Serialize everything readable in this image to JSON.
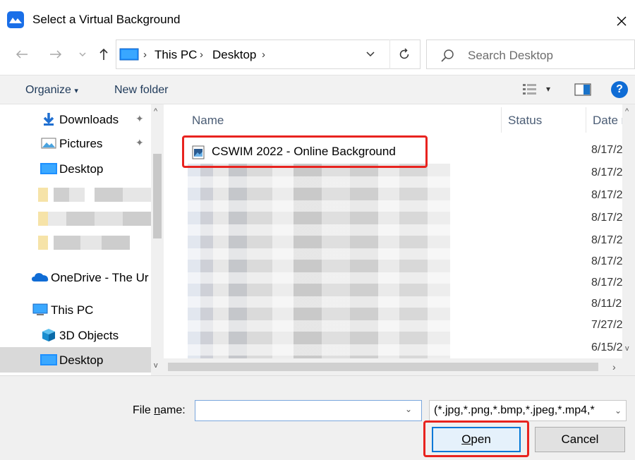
{
  "window": {
    "title": "Select a Virtual Background",
    "close_glyph": "✕"
  },
  "navigation": {
    "back_glyph": "←",
    "forward_glyph": "→",
    "recent_glyph": "⌄",
    "up_glyph": "↑"
  },
  "address_bar": {
    "breadcrumbs": [
      "This PC",
      "Desktop"
    ],
    "separator": "›",
    "dropdown_glyph": "⌄",
    "refresh_glyph": "↻"
  },
  "search": {
    "placeholder": "Search Desktop"
  },
  "command_bar": {
    "organize_label": "Organize",
    "organize_caret": "▾",
    "new_folder_label": "New folder",
    "view_caret": "▾",
    "help_glyph": "?"
  },
  "nav_pane": {
    "items": [
      {
        "label": "Downloads",
        "icon": "download-arrow-icon",
        "pinned": true
      },
      {
        "label": "Pictures",
        "icon": "pictures-folder-icon",
        "pinned": true
      },
      {
        "label": "Desktop",
        "icon": "desktop-folder-icon",
        "pinned": false
      },
      {
        "label": "OneDrive - The Ur",
        "icon": "onedrive-cloud-icon",
        "pinned": false
      },
      {
        "label": "This PC",
        "icon": "this-pc-icon",
        "pinned": false
      },
      {
        "label": "3D Objects",
        "icon": "3d-objects-icon",
        "pinned": false
      },
      {
        "label": "Desktop",
        "icon": "desktop-folder-icon",
        "pinned": false,
        "selected": true
      }
    ],
    "pin_glyph": "📌",
    "scroll_up_glyph": "^",
    "scroll_down_glyph": "v"
  },
  "file_list": {
    "columns": [
      "Name",
      "Status",
      "Date r"
    ],
    "files": [
      {
        "name": "CSWIM 2022 - Online Background",
        "date": "8/17/2"
      }
    ],
    "dates": [
      "8/17/2",
      "8/17/2",
      "8/17/2",
      "8/17/2",
      "8/17/2",
      "8/17/2",
      "8/17/2",
      "8/11/2",
      "7/27/2",
      "6/15/2"
    ],
    "scroll_right_glyph": "›"
  },
  "footer": {
    "file_name_label_prefix": "File ",
    "file_name_label_underline": "n",
    "file_name_label_suffix": "ame:",
    "file_name_value": "",
    "file_type_value": "(*.jpg,*.png,*.bmp,*.jpeg,*.mp4,*",
    "caret_glyph": "⌄",
    "open_label_underline": "O",
    "open_label_rest": "pen",
    "cancel_label": "Cancel"
  },
  "colors": {
    "accent": "#0078d7",
    "annotation_red": "#e8231f",
    "selected_bg": "#d9d9d9"
  }
}
